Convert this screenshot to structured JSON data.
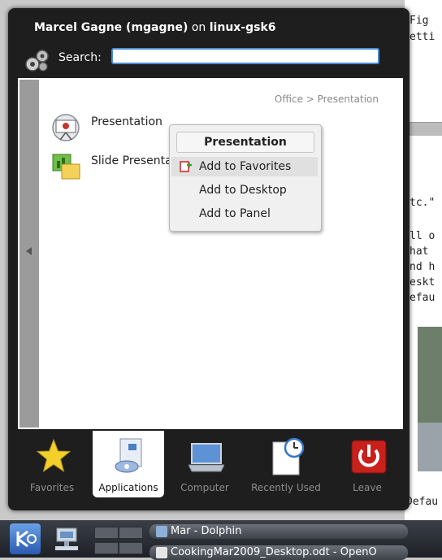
{
  "background_doc": {
    "lines": [
      "Fig",
      "etti",
      "tc.\"",
      "ll o",
      "hat ",
      "nd h",
      "eskt",
      "efau",
      "Defau"
    ]
  },
  "menu": {
    "user_name": "Marcel Gagne (mgagne)",
    "on_text": "on",
    "host": "linux-gsk6",
    "search_label": "Search:",
    "search_value": "",
    "breadcrumb": "Office > Presentation",
    "apps": [
      {
        "label": "Presentation",
        "icon": "presentation-icon"
      },
      {
        "label": "Slide Presentat",
        "icon": "slide-presentation-icon"
      }
    ],
    "context_menu": {
      "title": "Presentation",
      "items": [
        {
          "label": "Add to Favorites",
          "icon": "favorites-icon",
          "highlighted": true
        },
        {
          "label": "Add to Desktop"
        },
        {
          "label": "Add to Panel"
        }
      ]
    },
    "tabs": [
      {
        "label": "Favorites",
        "icon": "star-icon"
      },
      {
        "label": "Applications",
        "icon": "applications-icon",
        "active": true
      },
      {
        "label": "Computer",
        "icon": "computer-icon"
      },
      {
        "label": "Recently Used",
        "icon": "clock-icon"
      },
      {
        "label": "Leave",
        "icon": "power-icon"
      }
    ]
  },
  "taskbar": {
    "tasks": [
      {
        "label": "Mar - Dolphin"
      },
      {
        "label": "CookingMar2009_Desktop.odt - OpenO"
      }
    ]
  },
  "colors": {
    "accent": "#4a8cd8",
    "menu_bg": "#1e1e1e",
    "leave_red": "#c8201b"
  }
}
